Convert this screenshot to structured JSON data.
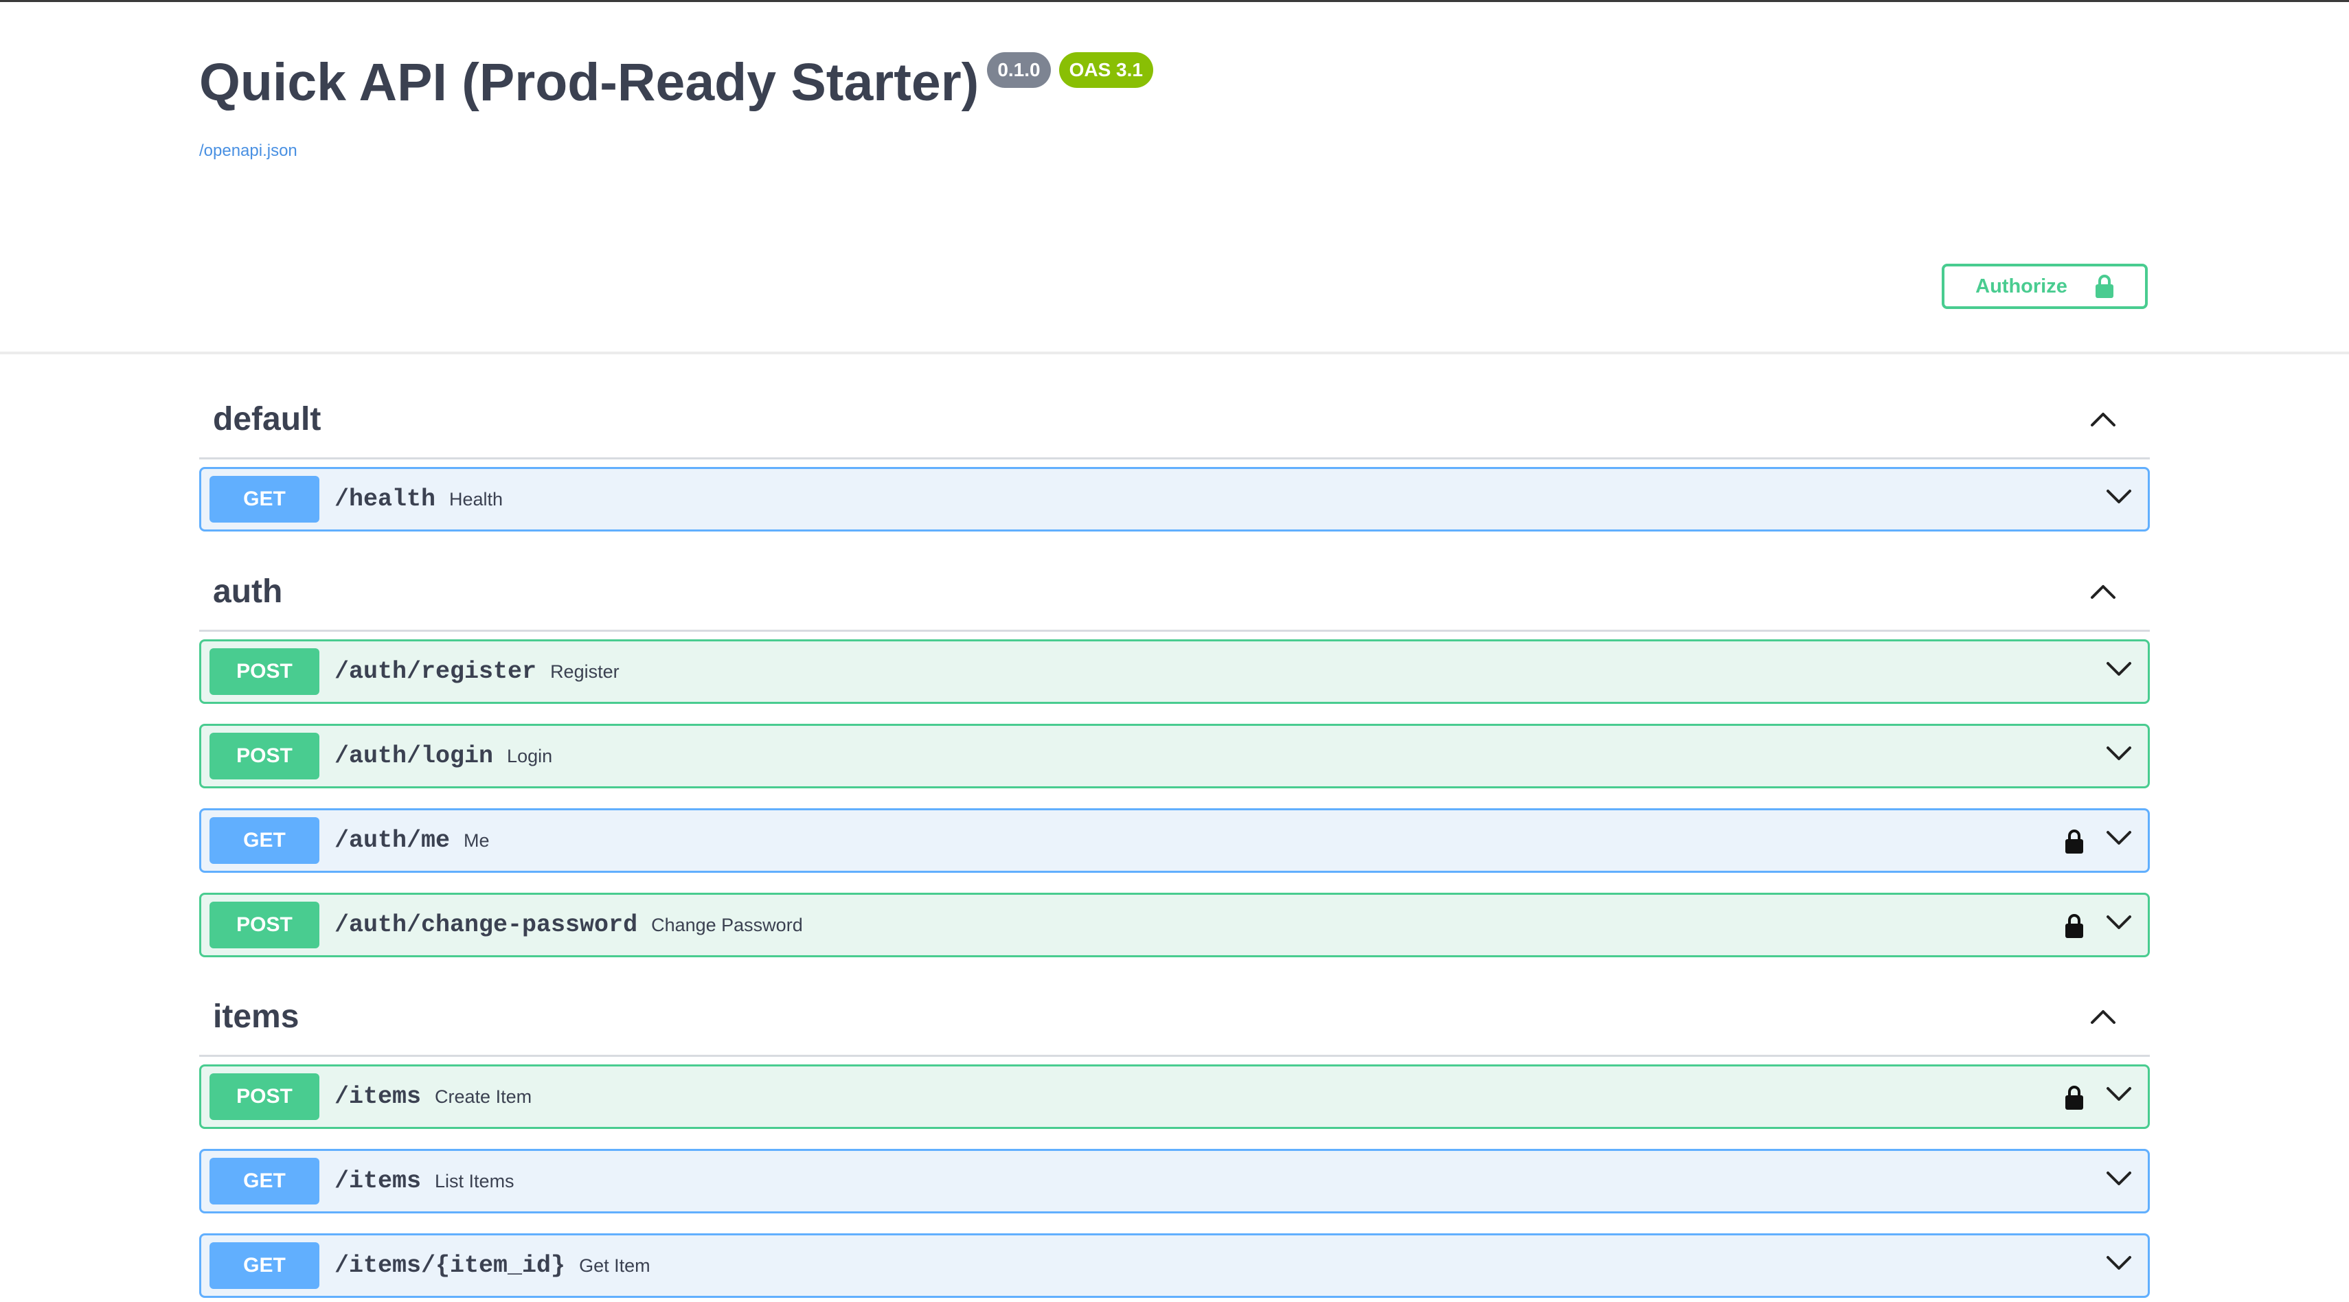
{
  "info": {
    "title": "Quick API (Prod-Ready Starter)",
    "version": "0.1.0",
    "oas": "OAS 3.1",
    "spec_link": "/openapi.json"
  },
  "authorize": {
    "label": "Authorize",
    "icon": "lock-icon"
  },
  "colors": {
    "get": "#61affe",
    "post": "#49cc90",
    "get_bg": "#ebf3fb",
    "post_bg": "#e8f6f0",
    "version_badge": "#7d8492",
    "oas_badge": "#89bf04",
    "link": "#4990e2"
  },
  "sections": [
    {
      "name": "default",
      "operations": [
        {
          "method": "GET",
          "path": "/health",
          "summary": "Health",
          "locked": false
        }
      ]
    },
    {
      "name": "auth",
      "operations": [
        {
          "method": "POST",
          "path": "/auth/register",
          "summary": "Register",
          "locked": false
        },
        {
          "method": "POST",
          "path": "/auth/login",
          "summary": "Login",
          "locked": false
        },
        {
          "method": "GET",
          "path": "/auth/me",
          "summary": "Me",
          "locked": true
        },
        {
          "method": "POST",
          "path": "/auth/change-password",
          "summary": "Change Password",
          "locked": true
        }
      ]
    },
    {
      "name": "items",
      "operations": [
        {
          "method": "POST",
          "path": "/items",
          "summary": "Create Item",
          "locked": true
        },
        {
          "method": "GET",
          "path": "/items",
          "summary": "List Items",
          "locked": false
        },
        {
          "method": "GET",
          "path": "/items/{item_id}",
          "summary": "Get Item",
          "locked": false
        }
      ]
    }
  ]
}
